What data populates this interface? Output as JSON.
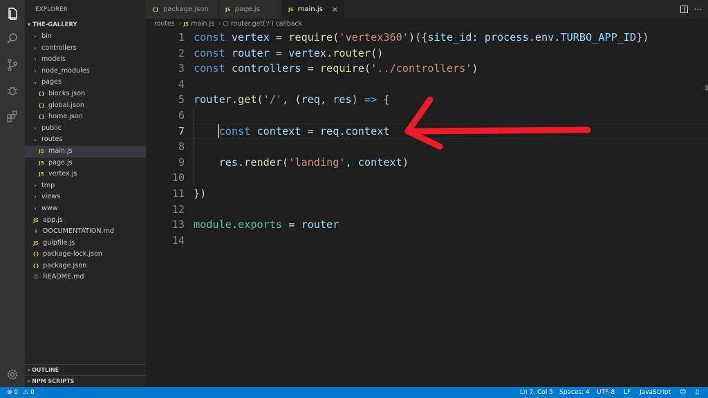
{
  "sidebar": {
    "title": "EXPLORER",
    "root": "THE-GALLERY",
    "tree": [
      {
        "label": "bin",
        "kind": "folder",
        "depth": 1,
        "expanded": false
      },
      {
        "label": "controllers",
        "kind": "folder",
        "depth": 1,
        "expanded": false
      },
      {
        "label": "models",
        "kind": "folder",
        "depth": 1,
        "expanded": false
      },
      {
        "label": "node_modules",
        "kind": "folder",
        "depth": 1,
        "expanded": false
      },
      {
        "label": "pages",
        "kind": "folder",
        "depth": 1,
        "expanded": true
      },
      {
        "label": "blocks.json",
        "kind": "json",
        "depth": 2
      },
      {
        "label": "global.json",
        "kind": "json",
        "depth": 2
      },
      {
        "label": "home.json",
        "kind": "json",
        "depth": 2
      },
      {
        "label": "public",
        "kind": "folder",
        "depth": 1,
        "expanded": false
      },
      {
        "label": "routes",
        "kind": "folder",
        "depth": 1,
        "expanded": true
      },
      {
        "label": "main.js",
        "kind": "js",
        "depth": 2,
        "selected": true
      },
      {
        "label": "page.js",
        "kind": "js",
        "depth": 2
      },
      {
        "label": "vertex.js",
        "kind": "js",
        "depth": 2
      },
      {
        "label": "tmp",
        "kind": "folder",
        "depth": 1,
        "expanded": false
      },
      {
        "label": "views",
        "kind": "folder",
        "depth": 1,
        "expanded": false
      },
      {
        "label": "www",
        "kind": "folder",
        "depth": 1,
        "expanded": false
      },
      {
        "label": "app.js",
        "kind": "js",
        "depth": 1
      },
      {
        "label": "DOCUMENTATION.md",
        "kind": "md",
        "depth": 1
      },
      {
        "label": "gulpfile.js",
        "kind": "js",
        "depth": 1
      },
      {
        "label": "package-lock.json",
        "kind": "json",
        "depth": 1
      },
      {
        "label": "package.json",
        "kind": "json",
        "depth": 1
      },
      {
        "label": "README.md",
        "kind": "info",
        "depth": 1
      }
    ],
    "outline": "OUTLINE",
    "npm_scripts": "NPM SCRIPTS"
  },
  "tabs": [
    {
      "label": "package.json",
      "icon": "{}",
      "active": false
    },
    {
      "label": "page.js",
      "icon": "JS",
      "active": false
    },
    {
      "label": "main.js",
      "icon": "JS",
      "active": true,
      "close": "×"
    }
  ],
  "breadcrumb": {
    "folder": "routes",
    "file_icon": "JS",
    "file": "main.js",
    "symbol": "router.get('/') callback"
  },
  "editor": {
    "current_line": 7,
    "lines": [
      "1",
      "2",
      "3",
      "4",
      "5",
      "6",
      "7",
      "8",
      "9",
      "10",
      "11",
      "12",
      "13",
      "14"
    ]
  },
  "status": {
    "errors": "0",
    "warnings": "0",
    "position": "Ln 7, Col 5",
    "spaces": "Spaces: 4",
    "encoding": "UTF-8",
    "eol": "LF",
    "language": "JavaScript"
  },
  "colors": {
    "accent": "#007acc",
    "annotation_arrow": "#f01a2a"
  },
  "icons": {
    "activity": [
      "files-icon",
      "search-icon",
      "source-control-icon",
      "debug-icon",
      "extensions-icon",
      "settings-gear-icon"
    ]
  }
}
